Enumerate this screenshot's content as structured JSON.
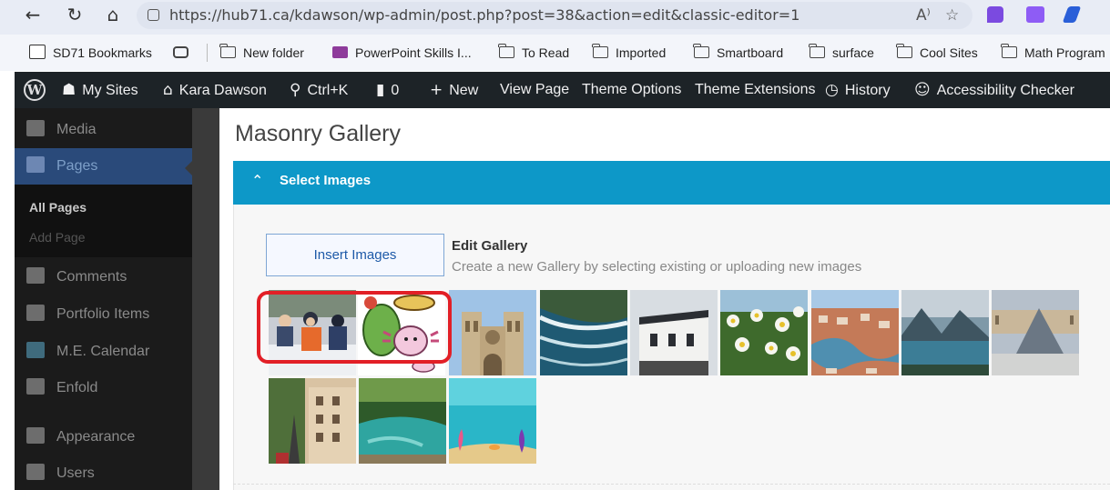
{
  "browser": {
    "url": "https://hub71.ca/kdawson/wp-admin/post.php?post=38&action=edit&classic-editor=1",
    "nav_icons": [
      "back-arrow-icon",
      "refresh-icon",
      "home-icon"
    ],
    "read_aloud_glyph": "A⁾",
    "favorite_glyph": "☆"
  },
  "bookmarks": [
    {
      "label": "SD71 Bookmarks",
      "icon": "bookmarks-folder-icon"
    },
    {
      "label": "",
      "icon": "tab-memory-icon"
    },
    {
      "label": "New folder",
      "icon": "folder-icon"
    },
    {
      "label": "PowerPoint Skills I...",
      "icon": "powerpoint-icon"
    },
    {
      "label": "To Read",
      "icon": "folder-icon"
    },
    {
      "label": "Imported",
      "icon": "folder-icon"
    },
    {
      "label": "Smartboard",
      "icon": "folder-icon"
    },
    {
      "label": "surface",
      "icon": "folder-icon"
    },
    {
      "label": "Cool Sites",
      "icon": "folder-icon"
    },
    {
      "label": "Math Program",
      "icon": "folder-icon"
    }
  ],
  "adminbar": {
    "my_sites": "My Sites",
    "site_name": "Kara Dawson",
    "search_shortcut": "Ctrl+K",
    "comments_count": "0",
    "new_label": "New",
    "view_page": "View Page",
    "theme_options": "Theme Options",
    "theme_extensions": "Theme Extensions",
    "history": "History",
    "accessibility_checker": "Accessibility Checker"
  },
  "sidebar": {
    "items": [
      {
        "label": "Media",
        "icon": "media-icon"
      },
      {
        "label": "Pages",
        "icon": "pages-icon",
        "active": true
      },
      {
        "label": "Comments",
        "icon": "comments-icon"
      },
      {
        "label": "Portfolio Items",
        "icon": "portfolio-icon"
      },
      {
        "label": "M.E. Calendar",
        "icon": "calendar-icon"
      },
      {
        "label": "Enfold",
        "icon": "enfold-icon"
      },
      {
        "label": "Appearance",
        "icon": "appearance-icon"
      },
      {
        "label": "Users",
        "icon": "users-icon"
      }
    ],
    "submenu": {
      "all_pages": "All Pages",
      "add_page": "Add Page"
    }
  },
  "editor": {
    "page_title": "Masonry Gallery",
    "section_title": "Select Images",
    "insert_button": "Insert Images",
    "edit_gallery_title": "Edit Gallery",
    "edit_gallery_desc": "Create a new Gallery by selecting existing or uploading new images",
    "images": [
      {
        "name": "kids-in-snow-photo",
        "selected": true
      },
      {
        "name": "axolotl-cactus-drawing",
        "selected": true
      },
      {
        "name": "notre-dame-cathedral-photo",
        "selected": false
      },
      {
        "name": "coastal-waves-aerial-photo",
        "selected": false
      },
      {
        "name": "modern-building-photo",
        "selected": false
      },
      {
        "name": "white-flowers-photo",
        "selected": false
      },
      {
        "name": "river-city-aerial-photo",
        "selected": false
      },
      {
        "name": "mountain-lake-photo",
        "selected": false
      },
      {
        "name": "louvre-pyramid-photo",
        "selected": false
      },
      {
        "name": "paris-street-photo",
        "selected": false
      },
      {
        "name": "forest-lagoon-photo",
        "selected": false
      },
      {
        "name": "underwater-cartoon-scene",
        "selected": false
      }
    ]
  },
  "colors": {
    "adminbar_bg": "#1d2327",
    "section_bar": "#0d98c8",
    "highlight": "#e21f26",
    "sidebar_active": "#2a4a7a"
  }
}
